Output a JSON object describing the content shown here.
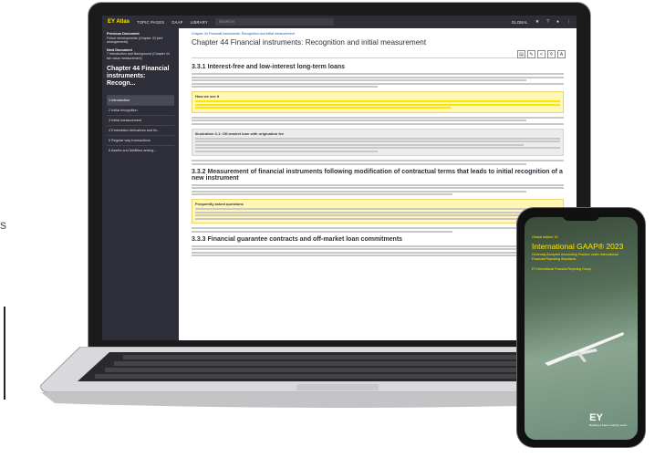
{
  "app": {
    "logo": "EY Atlas",
    "nav": [
      "TOPIC PAGES",
      "GAAP",
      "LIBRARY"
    ],
    "search_placeholder": "SEARCH",
    "region": "GLOBAL"
  },
  "sidebar": {
    "previous_label": "Previous Document",
    "previous_title": "Future developments (Chapter 43 joint arrangements)",
    "next_label": "Next Document",
    "next_title": "7 Introduction and Background (Chapter 44 fair value measurement)",
    "heading": "Chapter 44 Financial instruments: Recogn...",
    "toc": [
      "1 Introduction",
      "2 Initial recognition",
      "3 Initial measurement",
      "4 Embedded derivatives and fin...",
      "5 Regular way transactions",
      "6 Assets and liabilities arising..."
    ]
  },
  "main": {
    "breadcrumb": "Chapter 44 Financial instruments: Recognition and initial measurement",
    "chapter_title": "Chapter 44 Financial instruments: Recognition and initial measurement",
    "sections": [
      "3.3.1 Interest-free and low-interest long-term loans",
      "3.3.2 Measurement of financial instruments following modification of contractual terms that leads to initial recognition of a new instrument",
      "3.3.3 Financial guarantee contracts and off-market loan commitments"
    ],
    "box1_title": "How we see it",
    "box2_title": "Illustration 3-1: Off-market loan with origination fee",
    "box3_title": "Frequently asked questions"
  },
  "phone": {
    "tag": "Global edition 19",
    "title": "International GAAP® 2023",
    "subtitle": "Generally Accepted Accounting Practice under International Financial Reporting Standards",
    "subtitle2": "EY International Financial Reporting Group",
    "brand": "EY",
    "brand_tagline": "Building a better working world"
  }
}
